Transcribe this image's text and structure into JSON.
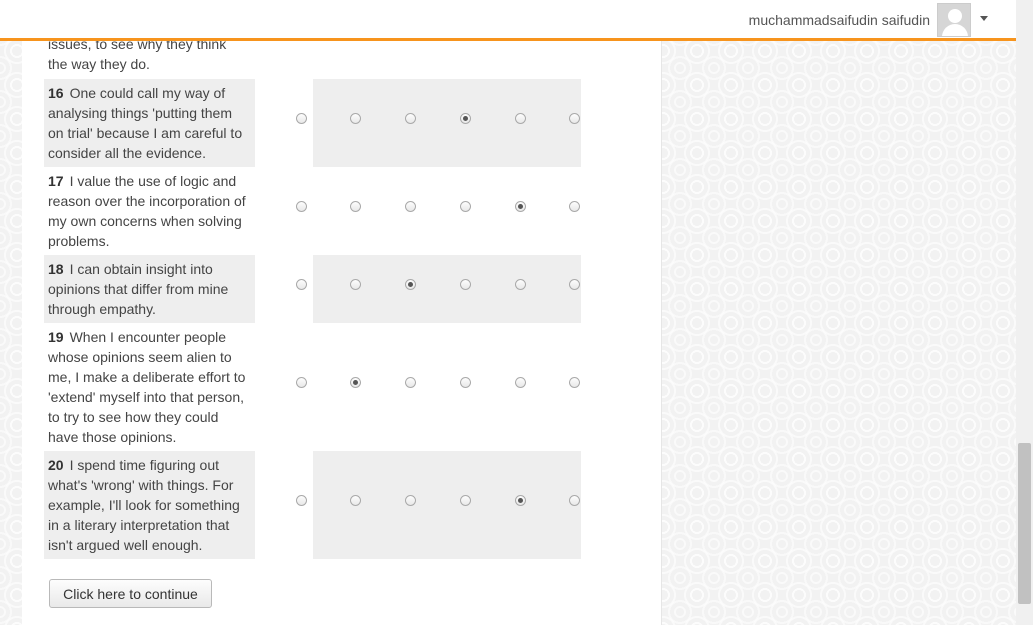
{
  "header": {
    "user_name": "muchammadsaifudin saifudin"
  },
  "partial_text": {
    "line1": "issues, to see why they think",
    "line2": "the way they do."
  },
  "questions": [
    {
      "num": "16",
      "text": "One could call my way of analysing things 'putting them on trial' because I am careful to consider all the evidence.",
      "selected": 4
    },
    {
      "num": "17",
      "text": "I value the use of logic and reason over the incorporation of my own concerns when solving problems.",
      "selected": 5
    },
    {
      "num": "18",
      "text": "I can obtain insight into opinions that differ from mine through empathy.",
      "selected": 3
    },
    {
      "num": "19",
      "text": "When I encounter people whose opinions seem alien to me, I make a deliberate effort to 'extend' myself into that person, to try to see how they could have those opinions.",
      "selected": 2
    },
    {
      "num": "20",
      "text": "I spend time figuring out what's 'wrong' with things. For example, I'll look for something in a literary interpretation that isn't argued well enough.",
      "selected": 5
    }
  ],
  "continue_label": "Click here to continue"
}
